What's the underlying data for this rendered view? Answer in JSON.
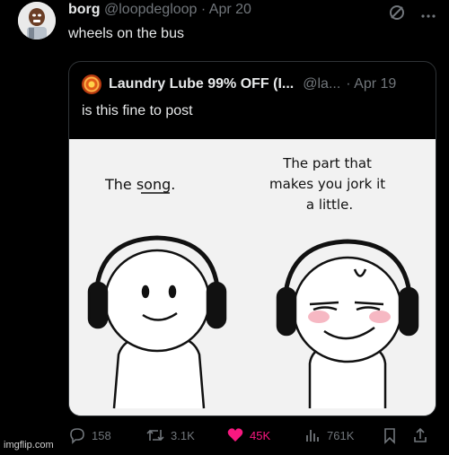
{
  "tweet": {
    "author_name": "borg",
    "handle": "@loopdegloop",
    "date": "· Apr 20",
    "text": "wheels on the bus"
  },
  "quote": {
    "author_name": "Laundry Lube 99% OFF (I...",
    "handle": "@la...",
    "date": "· Apr 19",
    "text": "is this fine to post",
    "comic": {
      "left_caption": "The song.",
      "right_caption_lines": [
        "The part that",
        "makes you jork it",
        "a little."
      ]
    }
  },
  "actions": {
    "replies": "158",
    "reposts": "3.1K",
    "likes": "45K",
    "views": "761K"
  },
  "colors": {
    "like": "#f91880",
    "muted": "#71767b",
    "text": "#e7e9ea"
  },
  "icons": [
    "grok-icon",
    "more-icon",
    "reply-icon",
    "repost-icon",
    "heart-icon",
    "views-icon",
    "bookmark-icon",
    "share-icon"
  ],
  "watermark": "imgflip.com"
}
